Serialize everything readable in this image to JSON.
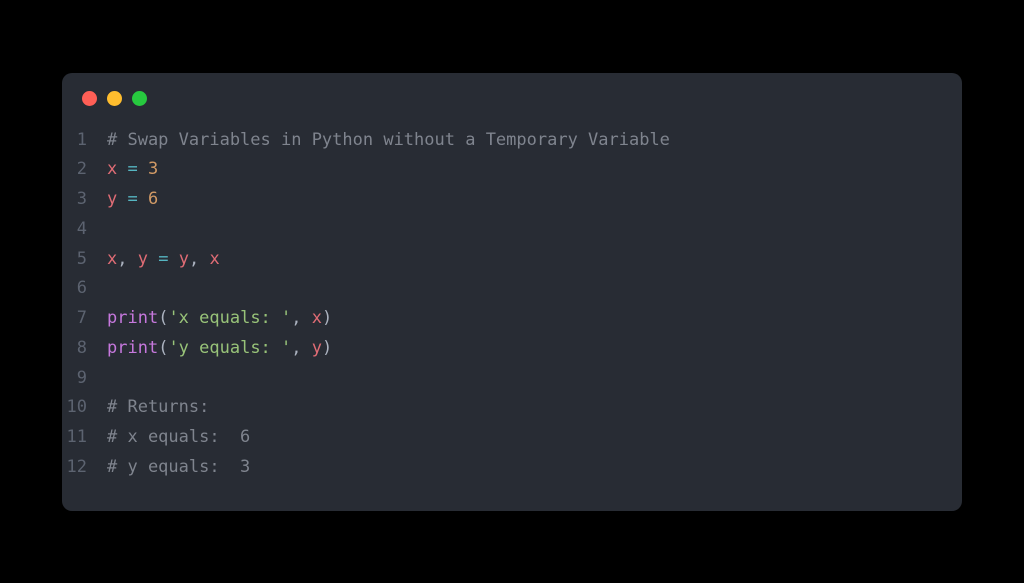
{
  "window": {
    "traffic_lights": [
      "red",
      "yellow",
      "green"
    ]
  },
  "code": {
    "lines": [
      {
        "n": 1,
        "tokens": [
          {
            "t": "# Swap Variables in Python without a Temporary Variable",
            "c": "comment"
          }
        ]
      },
      {
        "n": 2,
        "tokens": [
          {
            "t": "x",
            "c": "var"
          },
          {
            "t": " ",
            "c": "default"
          },
          {
            "t": "=",
            "c": "op"
          },
          {
            "t": " ",
            "c": "default"
          },
          {
            "t": "3",
            "c": "num"
          }
        ]
      },
      {
        "n": 3,
        "tokens": [
          {
            "t": "y",
            "c": "var"
          },
          {
            "t": " ",
            "c": "default"
          },
          {
            "t": "=",
            "c": "op"
          },
          {
            "t": " ",
            "c": "default"
          },
          {
            "t": "6",
            "c": "num"
          }
        ]
      },
      {
        "n": 4,
        "tokens": []
      },
      {
        "n": 5,
        "tokens": [
          {
            "t": "x",
            "c": "var"
          },
          {
            "t": ", ",
            "c": "punct"
          },
          {
            "t": "y",
            "c": "var"
          },
          {
            "t": " ",
            "c": "default"
          },
          {
            "t": "=",
            "c": "op"
          },
          {
            "t": " ",
            "c": "default"
          },
          {
            "t": "y",
            "c": "var"
          },
          {
            "t": ", ",
            "c": "punct"
          },
          {
            "t": "x",
            "c": "var"
          }
        ]
      },
      {
        "n": 6,
        "tokens": []
      },
      {
        "n": 7,
        "tokens": [
          {
            "t": "print",
            "c": "builtin"
          },
          {
            "t": "(",
            "c": "punct"
          },
          {
            "t": "'x equals: '",
            "c": "string"
          },
          {
            "t": ", ",
            "c": "punct"
          },
          {
            "t": "x",
            "c": "var"
          },
          {
            "t": ")",
            "c": "punct"
          }
        ]
      },
      {
        "n": 8,
        "tokens": [
          {
            "t": "print",
            "c": "builtin"
          },
          {
            "t": "(",
            "c": "punct"
          },
          {
            "t": "'y equals: '",
            "c": "string"
          },
          {
            "t": ", ",
            "c": "punct"
          },
          {
            "t": "y",
            "c": "var"
          },
          {
            "t": ")",
            "c": "punct"
          }
        ]
      },
      {
        "n": 9,
        "tokens": []
      },
      {
        "n": 10,
        "tokens": [
          {
            "t": "# Returns:",
            "c": "comment"
          }
        ]
      },
      {
        "n": 11,
        "tokens": [
          {
            "t": "# x equals:  6",
            "c": "comment"
          }
        ]
      },
      {
        "n": 12,
        "tokens": [
          {
            "t": "# y equals:  3",
            "c": "comment"
          }
        ]
      }
    ]
  }
}
